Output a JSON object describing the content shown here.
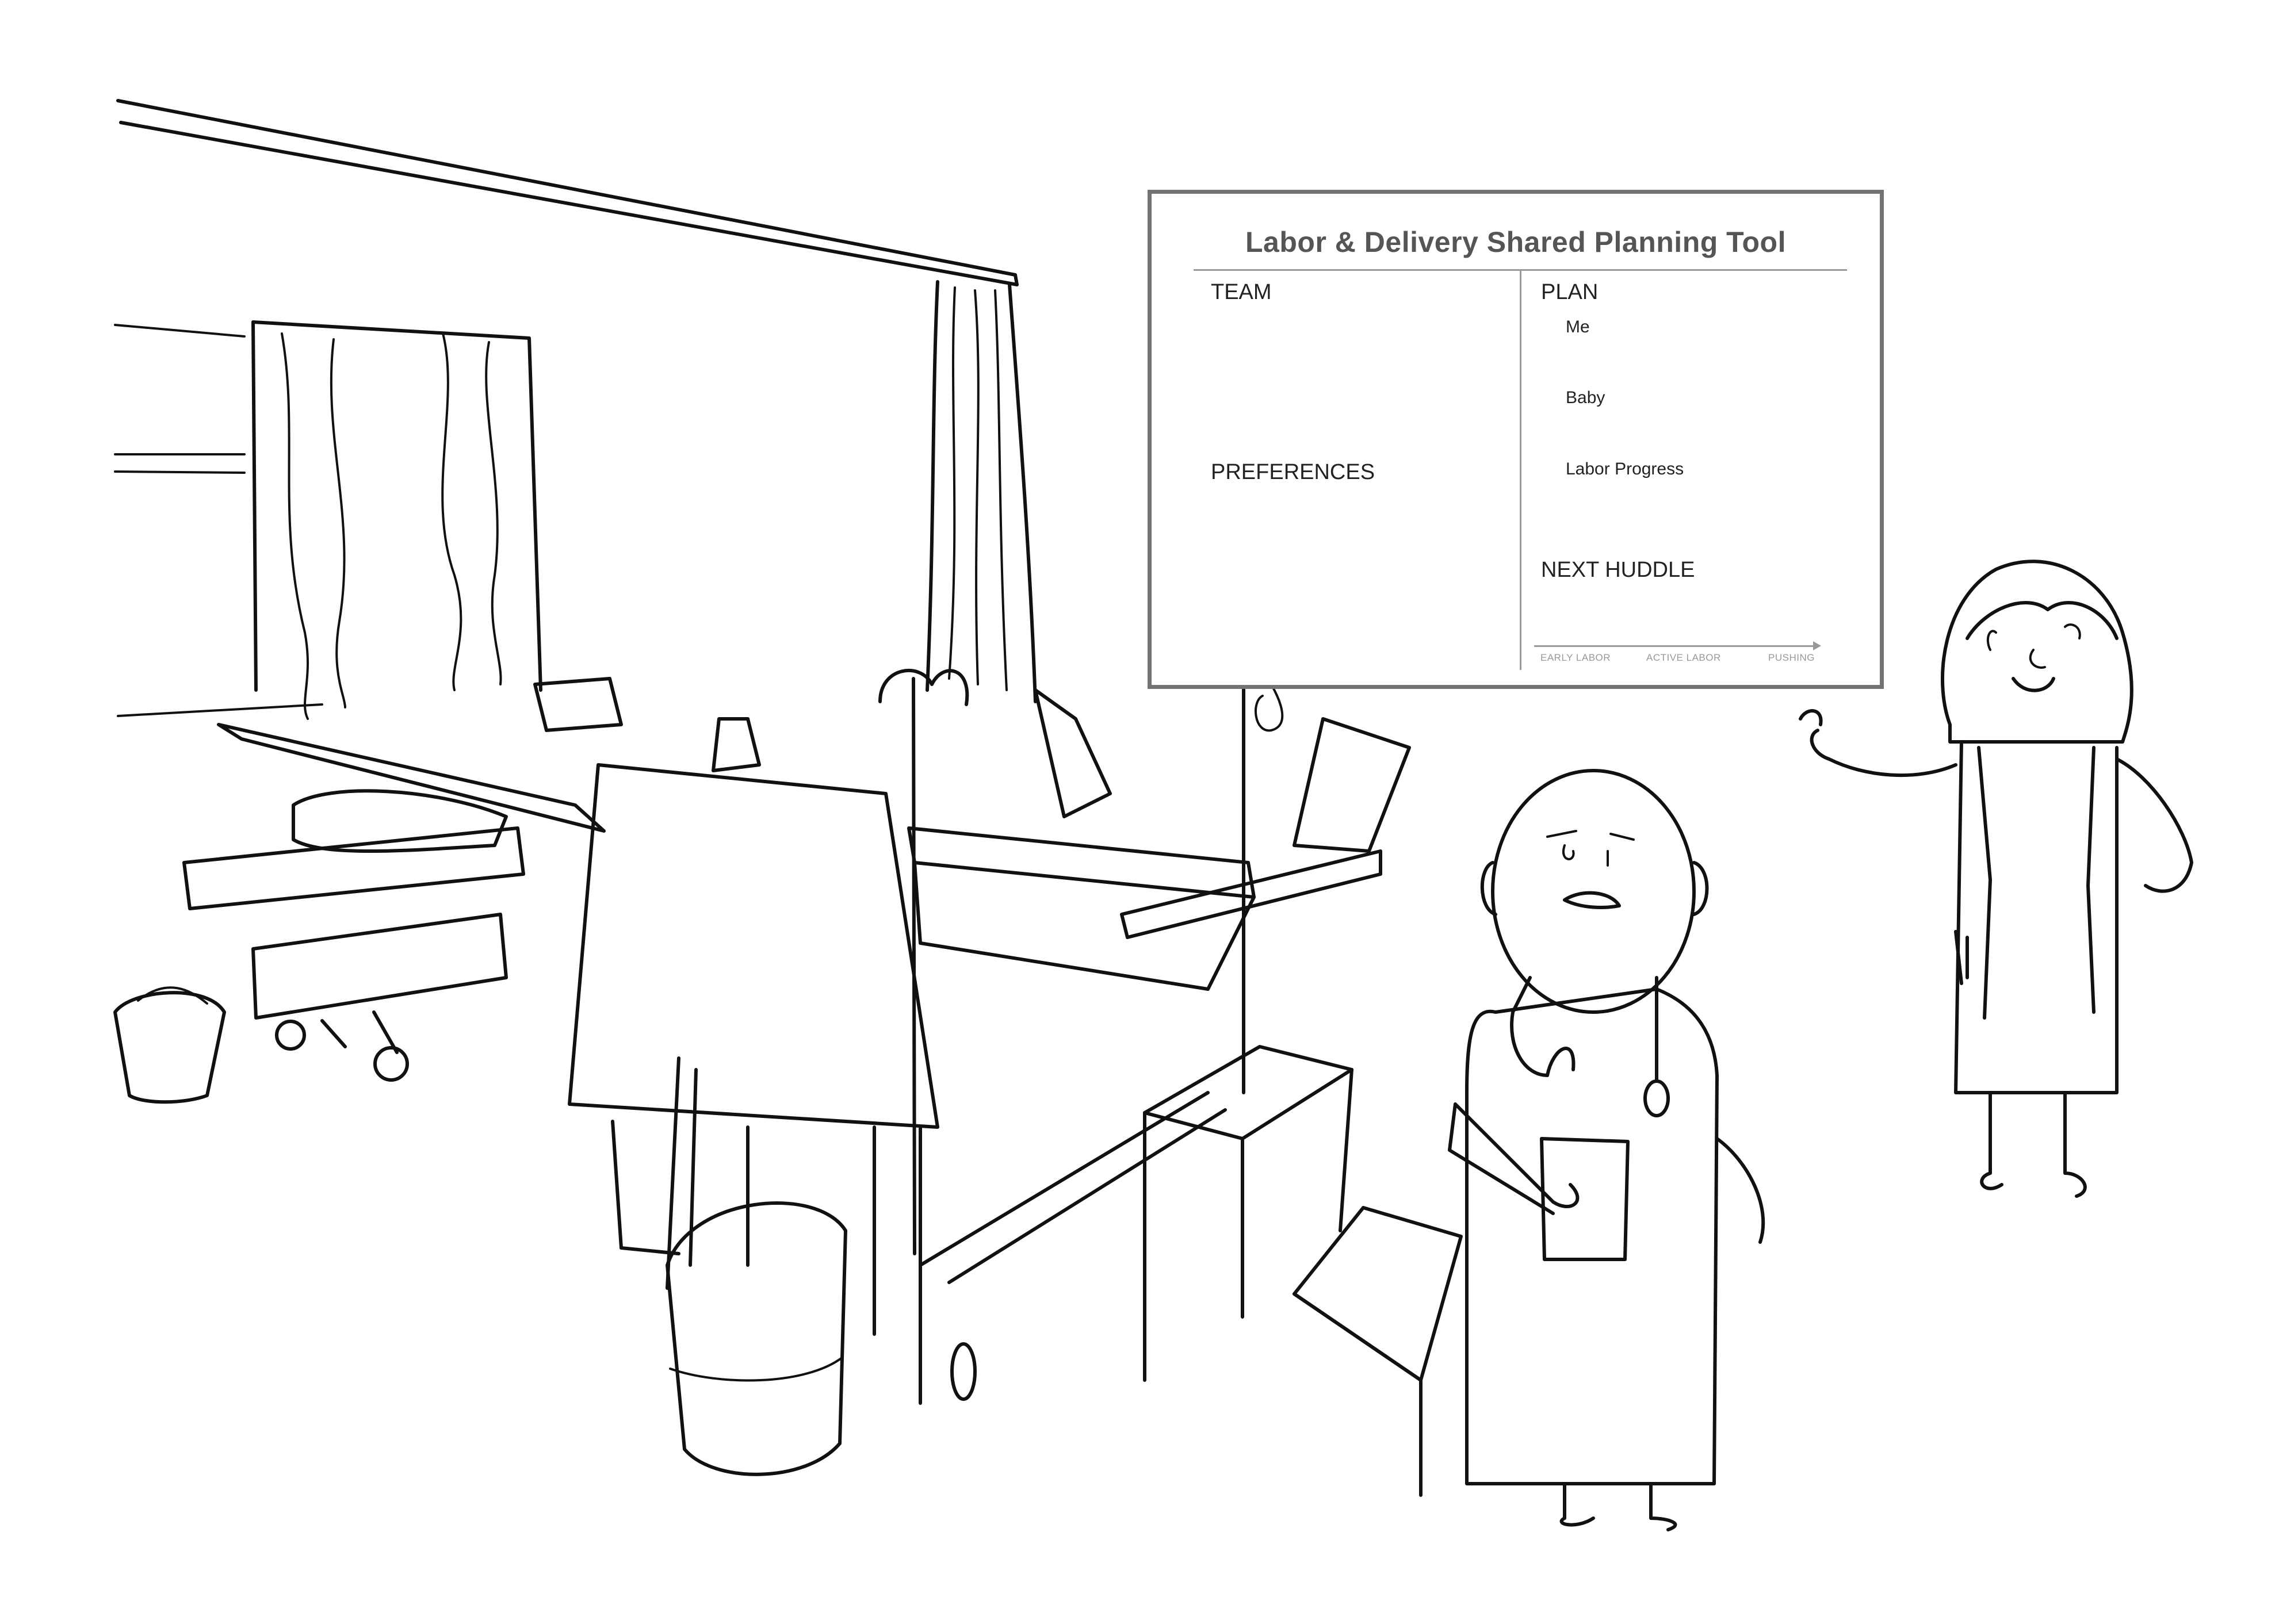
{
  "board": {
    "title": "Labor & Delivery Shared Planning Tool",
    "sections": {
      "team": "TEAM",
      "preferences": "PREFERENCES",
      "plan": "PLAN",
      "next_huddle": "NEXT HUDDLE"
    },
    "plan_items": {
      "me": "Me",
      "baby": "Baby",
      "labor_progress": "Labor Progress"
    },
    "progress_stages": {
      "early": "EARLY LABOR",
      "active": "ACTIVE LABOR",
      "pushing": "PUSHING"
    }
  },
  "colors": {
    "ink": "#111111",
    "board_frame": "#737373",
    "board_text": "#555555",
    "rule": "#999999",
    "background": "#ffffff"
  }
}
